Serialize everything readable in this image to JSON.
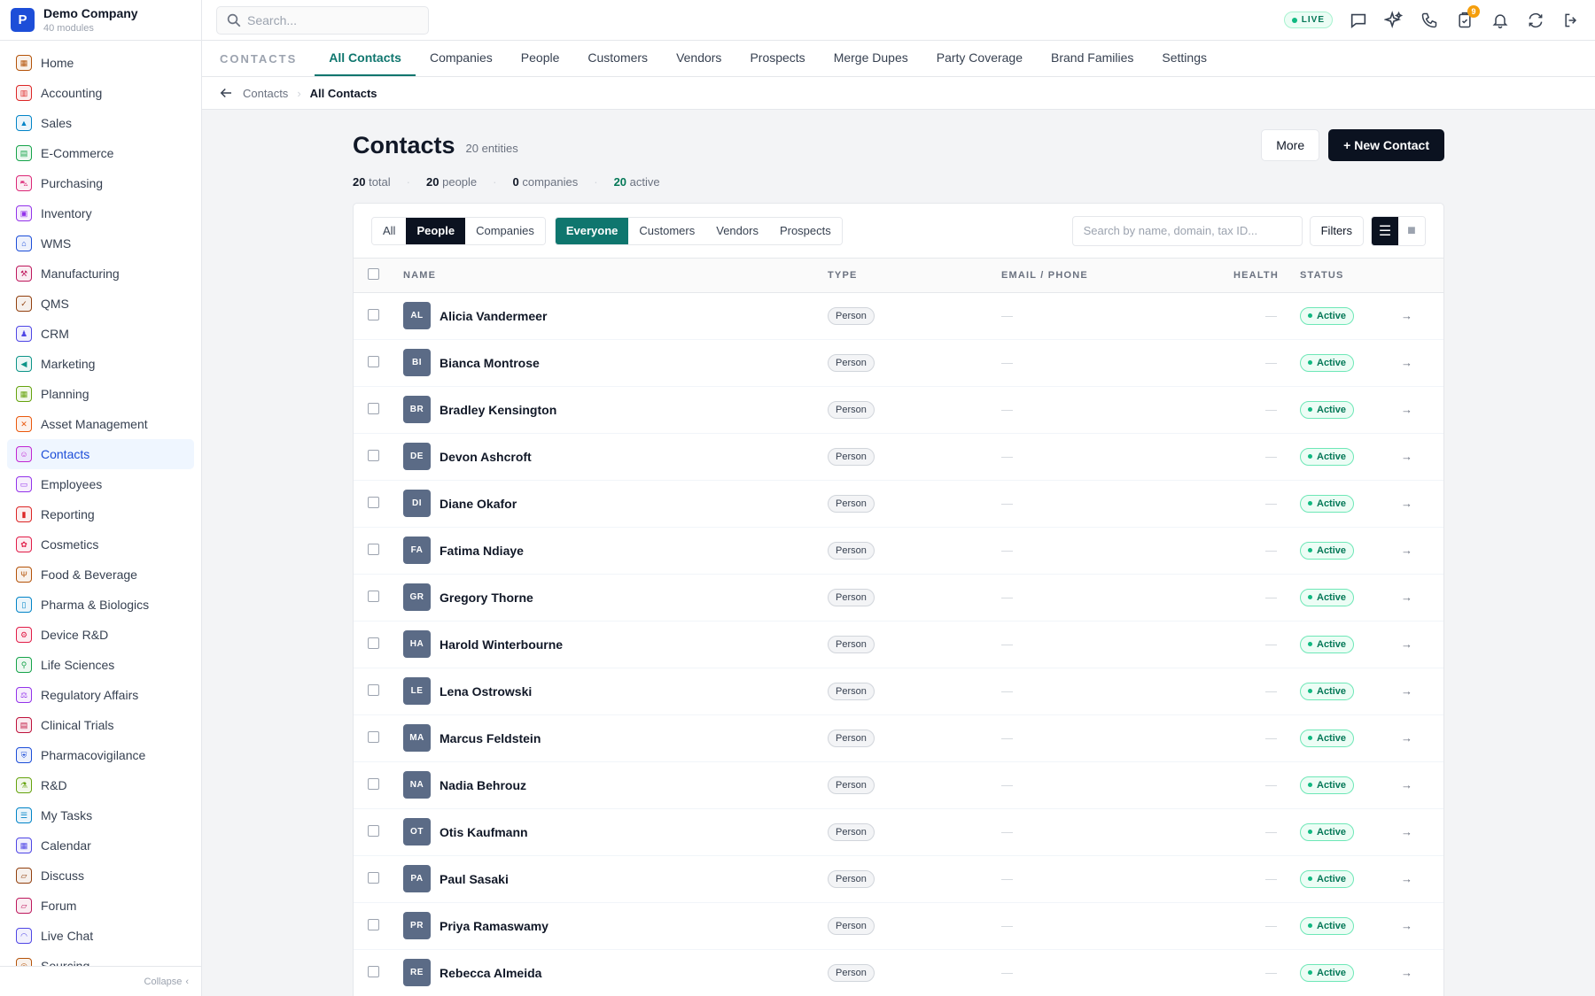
{
  "brand": {
    "logo": "P",
    "name": "Demo Company",
    "sub": "40 modules"
  },
  "sidebar": {
    "items": [
      {
        "label": "Home",
        "icon": "grid-icon",
        "color": "#b45309",
        "glyph": "▦"
      },
      {
        "label": "Accounting",
        "icon": "bank-icon",
        "color": "#dc2626",
        "glyph": "▥"
      },
      {
        "label": "Sales",
        "icon": "flask-icon",
        "color": "#0284c7",
        "glyph": "▲"
      },
      {
        "label": "E-Commerce",
        "icon": "store-icon",
        "color": "#16a34a",
        "glyph": "▤"
      },
      {
        "label": "Purchasing",
        "icon": "cart-icon",
        "color": "#db2777",
        "glyph": "⛍"
      },
      {
        "label": "Inventory",
        "icon": "box-icon",
        "color": "#9333ea",
        "glyph": "▣"
      },
      {
        "label": "WMS",
        "icon": "warehouse-icon",
        "color": "#1d4ed8",
        "glyph": "⌂"
      },
      {
        "label": "Manufacturing",
        "icon": "factory-icon",
        "color": "#be185d",
        "glyph": "⚒"
      },
      {
        "label": "QMS",
        "icon": "badge-check-icon",
        "color": "#92400e",
        "glyph": "✓"
      },
      {
        "label": "CRM",
        "icon": "users-icon",
        "color": "#4f46e5",
        "glyph": "♟"
      },
      {
        "label": "Marketing",
        "icon": "megaphone-icon",
        "color": "#0d9488",
        "glyph": "◀"
      },
      {
        "label": "Planning",
        "icon": "calendar-grid-icon",
        "color": "#65a30d",
        "glyph": "▦"
      },
      {
        "label": "Asset Management",
        "icon": "tools-icon",
        "color": "#ea580c",
        "glyph": "✕"
      },
      {
        "label": "Contacts",
        "icon": "contact-card-icon",
        "color": "#c026d3",
        "glyph": "☺"
      },
      {
        "label": "Employees",
        "icon": "briefcase-icon",
        "color": "#9333ea",
        "glyph": "▭"
      },
      {
        "label": "Reporting",
        "icon": "bar-chart-icon",
        "color": "#dc2626",
        "glyph": "▮"
      },
      {
        "label": "Cosmetics",
        "icon": "flower-icon",
        "color": "#e11d48",
        "glyph": "✿"
      },
      {
        "label": "Food & Beverage",
        "icon": "utensils-icon",
        "color": "#b45309",
        "glyph": "Ψ"
      },
      {
        "label": "Pharma & Biologics",
        "icon": "pill-icon",
        "color": "#0284c7",
        "glyph": "▯"
      },
      {
        "label": "Device R&D",
        "icon": "cog-icon",
        "color": "#e11d48",
        "glyph": "⚙"
      },
      {
        "label": "Life Sciences",
        "icon": "microscope-icon",
        "color": "#16a34a",
        "glyph": "⚲"
      },
      {
        "label": "Regulatory Affairs",
        "icon": "gavel-icon",
        "color": "#9333ea",
        "glyph": "⚖"
      },
      {
        "label": "Clinical Trials",
        "icon": "clipboard-icon",
        "color": "#be123c",
        "glyph": "▤"
      },
      {
        "label": "Pharmacovigilance",
        "icon": "shield-icon",
        "color": "#1d4ed8",
        "glyph": "⛨"
      },
      {
        "label": "R&D",
        "icon": "beaker-icon",
        "color": "#65a30d",
        "glyph": "⚗"
      },
      {
        "label": "My Tasks",
        "icon": "checklist-icon",
        "color": "#0284c7",
        "glyph": "☰"
      },
      {
        "label": "Calendar",
        "icon": "calendar-icon",
        "color": "#4f46e5",
        "glyph": "▦"
      },
      {
        "label": "Discuss",
        "icon": "chat-icon",
        "color": "#92400e",
        "glyph": "▱"
      },
      {
        "label": "Forum",
        "icon": "forum-icon",
        "color": "#be185d",
        "glyph": "▱"
      },
      {
        "label": "Live Chat",
        "icon": "headset-icon",
        "color": "#4f46e5",
        "glyph": "◠"
      },
      {
        "label": "Sourcing",
        "icon": "sourcing-icon",
        "color": "#b45309",
        "glyph": "◎"
      }
    ],
    "active_index": 13,
    "collapse_label": "Collapse"
  },
  "topbar": {
    "search_placeholder": "Search...",
    "live_label": "LIVE",
    "task_badge": "9"
  },
  "tabs": {
    "section": "CONTACTS",
    "items": [
      "All Contacts",
      "Companies",
      "People",
      "Customers",
      "Vendors",
      "Prospects",
      "Merge Dupes",
      "Party Coverage",
      "Brand Families",
      "Settings"
    ],
    "active_index": 0
  },
  "breadcrumb": {
    "parent": "Contacts",
    "current": "All Contacts"
  },
  "page": {
    "title": "Contacts",
    "subtitle": "20 entities",
    "more_label": "More",
    "new_label": "+ New Contact"
  },
  "stats": {
    "total": "20",
    "total_label": "total",
    "people": "20",
    "people_label": "people",
    "companies": "0",
    "companies_label": "companies",
    "active": "20",
    "active_label": "active"
  },
  "filters": {
    "kind": [
      "All",
      "People",
      "Companies"
    ],
    "kind_active": 1,
    "relation": [
      "Everyone",
      "Customers",
      "Vendors",
      "Prospects"
    ],
    "relation_active": 0,
    "search_placeholder": "Search by name, domain, tax ID...",
    "filters_label": "Filters"
  },
  "table": {
    "columns": [
      "NAME",
      "TYPE",
      "EMAIL / PHONE",
      "HEALTH",
      "STATUS"
    ],
    "rows": [
      {
        "initials": "AL",
        "name": "Alicia Vandermeer",
        "type": "Person",
        "contact": "—",
        "health": "—",
        "status": "Active"
      },
      {
        "initials": "BI",
        "name": "Bianca Montrose",
        "type": "Person",
        "contact": "—",
        "health": "—",
        "status": "Active"
      },
      {
        "initials": "BR",
        "name": "Bradley Kensington",
        "type": "Person",
        "contact": "—",
        "health": "—",
        "status": "Active"
      },
      {
        "initials": "DE",
        "name": "Devon Ashcroft",
        "type": "Person",
        "contact": "—",
        "health": "—",
        "status": "Active"
      },
      {
        "initials": "DI",
        "name": "Diane Okafor",
        "type": "Person",
        "contact": "—",
        "health": "—",
        "status": "Active"
      },
      {
        "initials": "FA",
        "name": "Fatima Ndiaye",
        "type": "Person",
        "contact": "—",
        "health": "—",
        "status": "Active"
      },
      {
        "initials": "GR",
        "name": "Gregory Thorne",
        "type": "Person",
        "contact": "—",
        "health": "—",
        "status": "Active"
      },
      {
        "initials": "HA",
        "name": "Harold Winterbourne",
        "type": "Person",
        "contact": "—",
        "health": "—",
        "status": "Active"
      },
      {
        "initials": "LE",
        "name": "Lena Ostrowski",
        "type": "Person",
        "contact": "—",
        "health": "—",
        "status": "Active"
      },
      {
        "initials": "MA",
        "name": "Marcus Feldstein",
        "type": "Person",
        "contact": "—",
        "health": "—",
        "status": "Active"
      },
      {
        "initials": "NA",
        "name": "Nadia Behrouz",
        "type": "Person",
        "contact": "—",
        "health": "—",
        "status": "Active"
      },
      {
        "initials": "OT",
        "name": "Otis Kaufmann",
        "type": "Person",
        "contact": "—",
        "health": "—",
        "status": "Active"
      },
      {
        "initials": "PA",
        "name": "Paul Sasaki",
        "type": "Person",
        "contact": "—",
        "health": "—",
        "status": "Active"
      },
      {
        "initials": "PR",
        "name": "Priya Ramaswamy",
        "type": "Person",
        "contact": "—",
        "health": "—",
        "status": "Active"
      },
      {
        "initials": "RE",
        "name": "Rebecca Almeida",
        "type": "Person",
        "contact": "—",
        "health": "—",
        "status": "Active"
      }
    ]
  },
  "colors": {
    "accent": "#0f766e",
    "primary": "#0b1220",
    "status_green": "#047857"
  }
}
